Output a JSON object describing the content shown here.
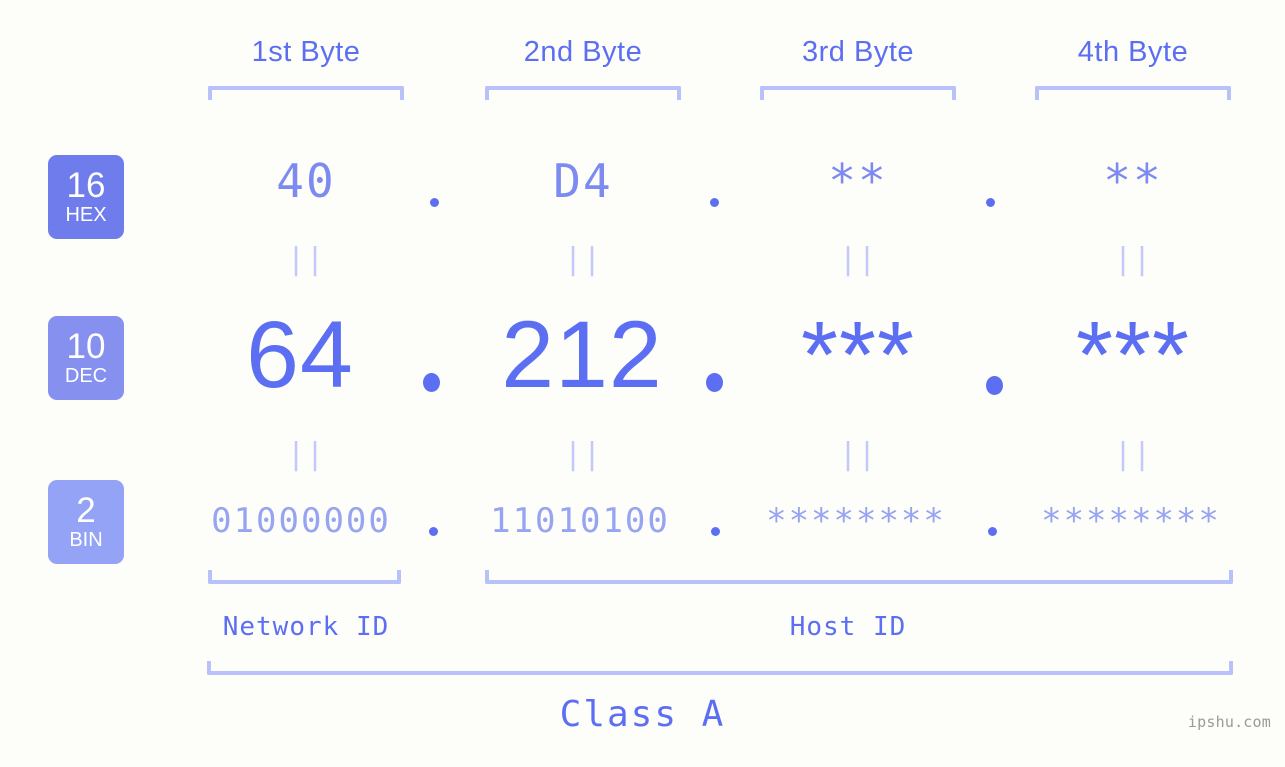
{
  "background_color": "#fdfdfa",
  "accent_color": "#5c6ff2",
  "bracket_color": "#b9c1fb",
  "byte_headers": [
    {
      "label": "1st Byte"
    },
    {
      "label": "2nd Byte"
    },
    {
      "label": "3rd Byte"
    },
    {
      "label": "4th Byte"
    }
  ],
  "rows": [
    {
      "base_number": "16",
      "base_name": "HEX",
      "badge_color": "#6f7ceb",
      "values": [
        "40",
        "D4",
        "**",
        "**"
      ],
      "separator": "."
    },
    {
      "base_number": "10",
      "base_name": "DEC",
      "badge_color": "#8690ef",
      "values": [
        "64",
        "212",
        "***",
        "***"
      ],
      "separator": "."
    },
    {
      "base_number": "2",
      "base_name": "BIN",
      "badge_color": "#94a3f5",
      "values": [
        "01000000",
        "11010100",
        "********",
        "********"
      ],
      "separator": "."
    }
  ],
  "equals_marker": "||",
  "id_sections": [
    {
      "label": "Network ID"
    },
    {
      "label": "Host ID"
    }
  ],
  "class_label": "Class A",
  "watermark": "ipshu.com"
}
